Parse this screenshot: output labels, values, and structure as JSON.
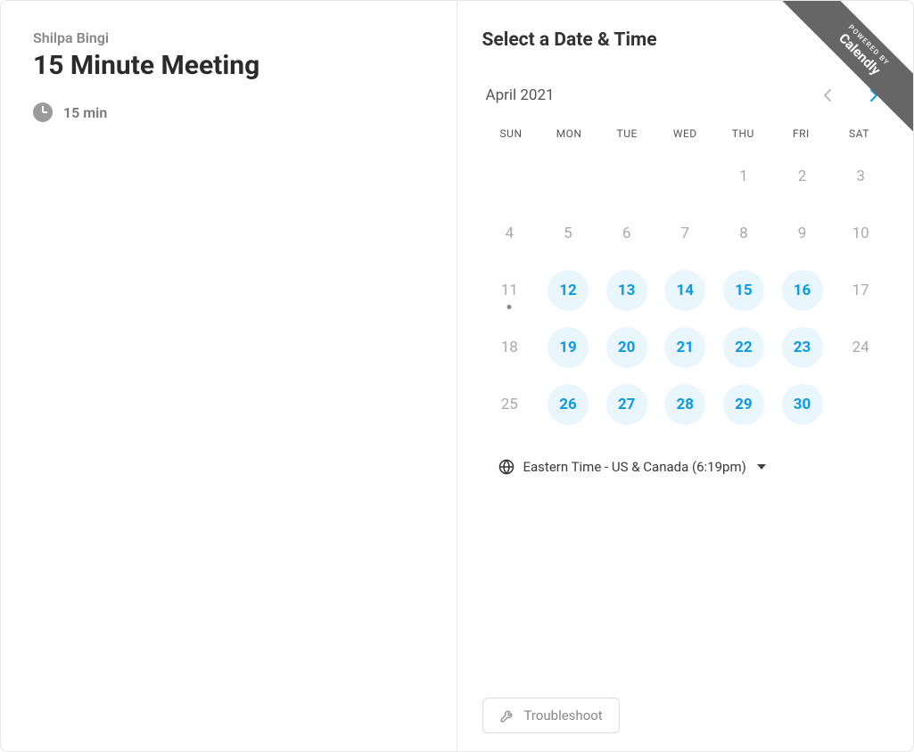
{
  "host": {
    "name": "Shilpa Bingi"
  },
  "meeting": {
    "title": "15 Minute Meeting",
    "duration_label": "15 min"
  },
  "right": {
    "heading": "Select a Date & Time",
    "month_label": "April 2021",
    "weekdays": [
      "SUN",
      "MON",
      "TUE",
      "WED",
      "THU",
      "FRI",
      "SAT"
    ],
    "days": [
      {
        "n": "",
        "available": false,
        "today": false
      },
      {
        "n": "",
        "available": false,
        "today": false
      },
      {
        "n": "",
        "available": false,
        "today": false
      },
      {
        "n": "",
        "available": false,
        "today": false
      },
      {
        "n": "1",
        "available": false,
        "today": false
      },
      {
        "n": "2",
        "available": false,
        "today": false
      },
      {
        "n": "3",
        "available": false,
        "today": false
      },
      {
        "n": "4",
        "available": false,
        "today": false
      },
      {
        "n": "5",
        "available": false,
        "today": false
      },
      {
        "n": "6",
        "available": false,
        "today": false
      },
      {
        "n": "7",
        "available": false,
        "today": false
      },
      {
        "n": "8",
        "available": false,
        "today": false
      },
      {
        "n": "9",
        "available": false,
        "today": false
      },
      {
        "n": "10",
        "available": false,
        "today": false
      },
      {
        "n": "11",
        "available": false,
        "today": true
      },
      {
        "n": "12",
        "available": true,
        "today": false
      },
      {
        "n": "13",
        "available": true,
        "today": false
      },
      {
        "n": "14",
        "available": true,
        "today": false
      },
      {
        "n": "15",
        "available": true,
        "today": false
      },
      {
        "n": "16",
        "available": true,
        "today": false
      },
      {
        "n": "17",
        "available": false,
        "today": false
      },
      {
        "n": "18",
        "available": false,
        "today": false
      },
      {
        "n": "19",
        "available": true,
        "today": false
      },
      {
        "n": "20",
        "available": true,
        "today": false
      },
      {
        "n": "21",
        "available": true,
        "today": false
      },
      {
        "n": "22",
        "available": true,
        "today": false
      },
      {
        "n": "23",
        "available": true,
        "today": false
      },
      {
        "n": "24",
        "available": false,
        "today": false
      },
      {
        "n": "25",
        "available": false,
        "today": false
      },
      {
        "n": "26",
        "available": true,
        "today": false
      },
      {
        "n": "27",
        "available": true,
        "today": false
      },
      {
        "n": "28",
        "available": true,
        "today": false
      },
      {
        "n": "29",
        "available": true,
        "today": false
      },
      {
        "n": "30",
        "available": true,
        "today": false
      }
    ],
    "timezone_label": "Eastern Time - US & Canada (6:19pm)",
    "troubleshoot_label": "Troubleshoot"
  },
  "ribbon": {
    "small": "POWERED BY",
    "big": "Calendly"
  },
  "colors": {
    "accent": "#0d9ae5",
    "available_bg": "#eaf6fd",
    "muted": "#aaa"
  }
}
